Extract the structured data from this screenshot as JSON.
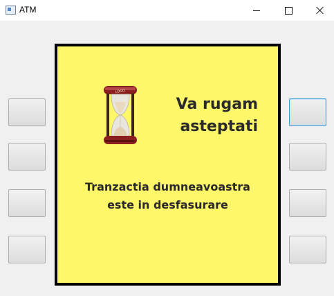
{
  "window": {
    "title": "ATM",
    "controls": [
      "minimize-icon",
      "maximize-icon",
      "close-icon"
    ]
  },
  "screen": {
    "background": "#fff76a",
    "title_line1": "Va rugam",
    "title_line2": "asteptati",
    "body_line1": "Tranzactia dumneavoastra",
    "body_line2": "este in desfasurare",
    "icon": "hourglass-icon",
    "hourglass_logo_text": "LOGO"
  },
  "side_buttons": {
    "left": [
      "",
      "",
      "",
      ""
    ],
    "right": [
      "",
      "",
      "",
      ""
    ],
    "focused": "right-1"
  }
}
